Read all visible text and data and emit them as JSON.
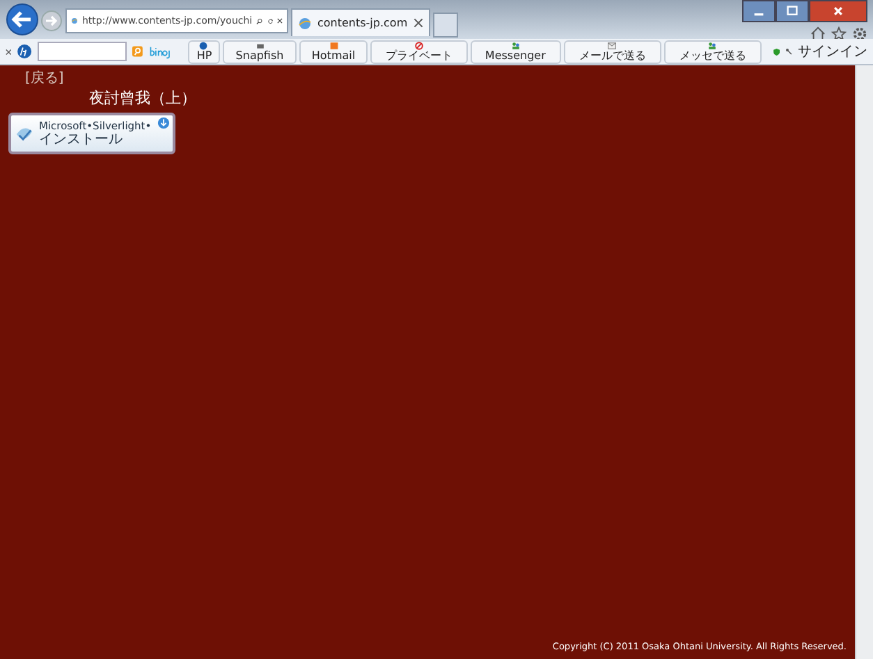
{
  "browser": {
    "address": "http://www.contents-jp.com/youchi",
    "tab_title": "contents-jp.com"
  },
  "toolbar": {
    "buttons": [
      {
        "label": "HP",
        "kind": "hp"
      },
      {
        "label": "Snapfish",
        "kind": "photo"
      },
      {
        "label": "Hotmail",
        "kind": "mail"
      },
      {
        "label": "プライベート",
        "kind": "private"
      },
      {
        "label": "Messenger",
        "kind": "people"
      },
      {
        "label": "メールで送る",
        "kind": "envelope"
      },
      {
        "label": "メッセで送る",
        "kind": "people"
      }
    ],
    "signin": "サインイン"
  },
  "page": {
    "back_link": "[戻る]",
    "title": "夜討曾我（上）",
    "plugin_badge": {
      "line_1": "Microsoft•Silverlight•",
      "line_2": "インストール"
    },
    "copyright": "Copyright (C) 2011 Osaka Ohtani University. All Rights Reserved."
  }
}
